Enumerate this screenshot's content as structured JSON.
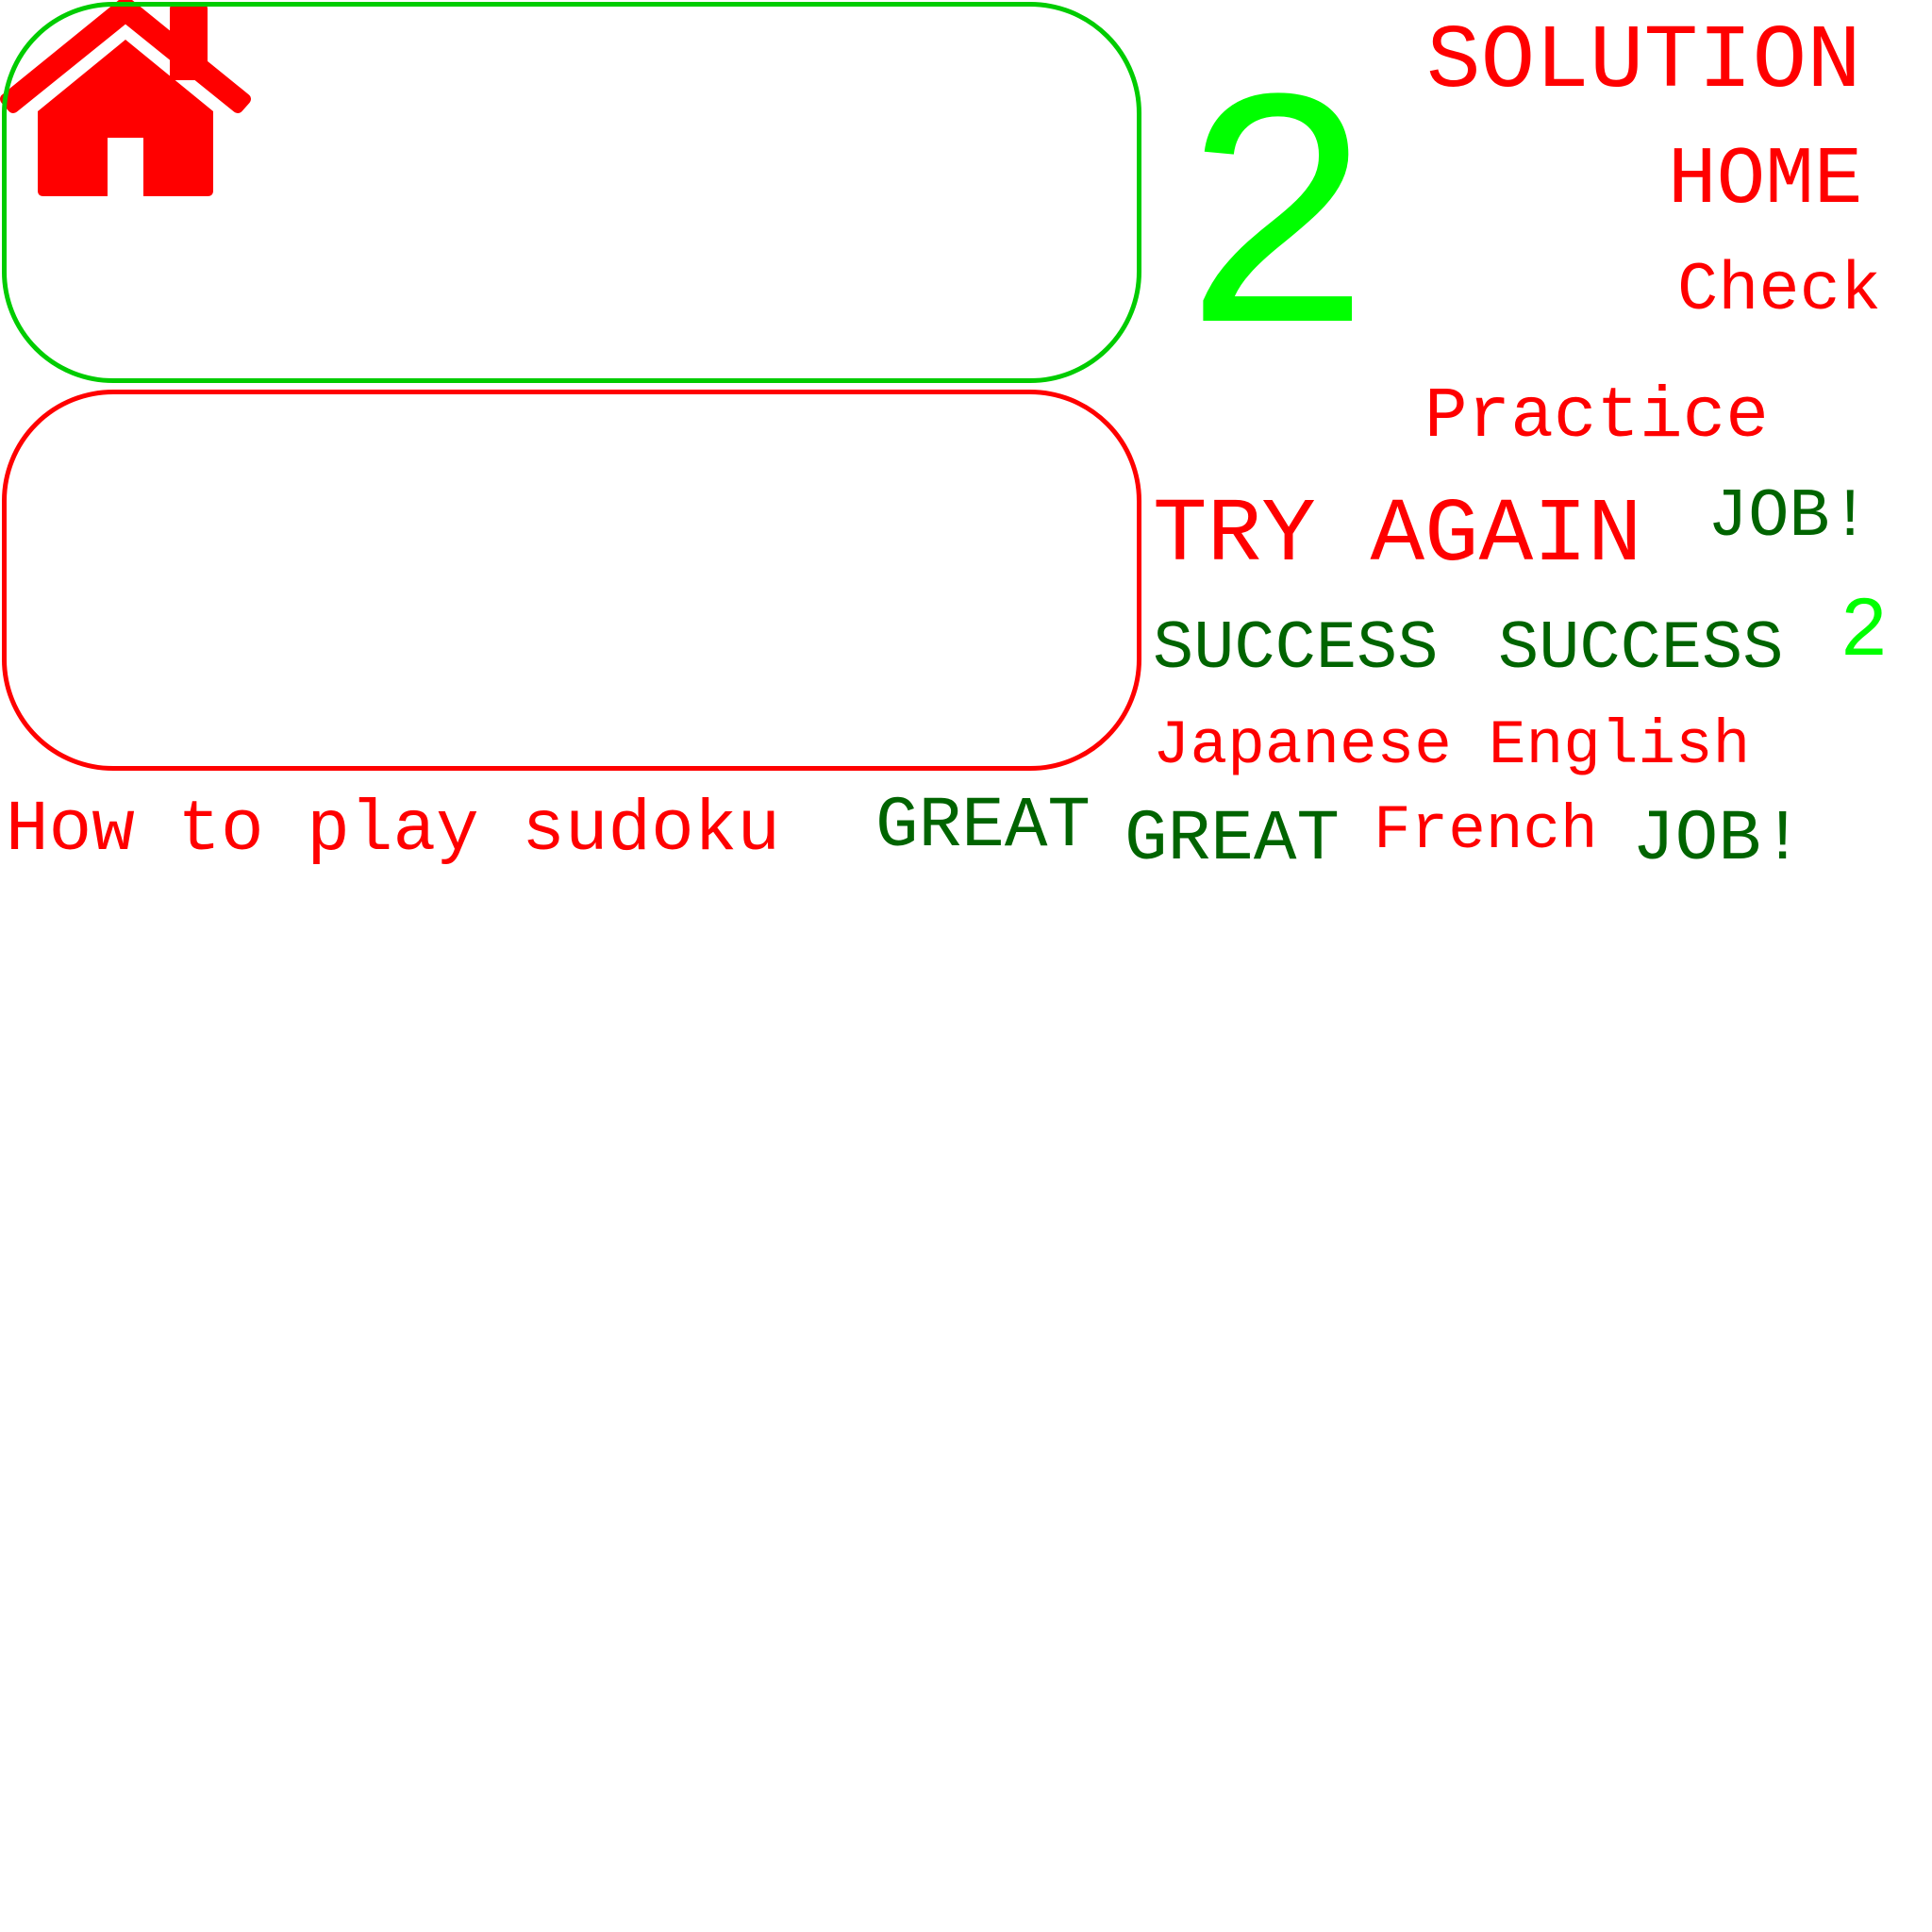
{
  "sheet": {
    "big_digit": "2",
    "small_digit": "2",
    "labels": {
      "solution": "SOLUTION",
      "home": "HOME",
      "check": "Check",
      "practice": "Practice",
      "try_again": "TRY AGAIN",
      "job_1": "JOB!",
      "success_1": "SUCCESS",
      "success_2": "SUCCESS",
      "japanese": "Japanese",
      "english": "English",
      "how_to_play": "How to play sudoku",
      "great_1": "GREAT",
      "great_2": "GREAT",
      "french": "French",
      "job_2": "JOB!"
    },
    "icons": {
      "home": "home-icon"
    },
    "colors": {
      "red": "#ff0000",
      "dark_green": "#006400",
      "lime": "#00ff00",
      "frame_green": "#00cc00",
      "frame_red": "#ff0000",
      "background": "#ffffff"
    }
  }
}
